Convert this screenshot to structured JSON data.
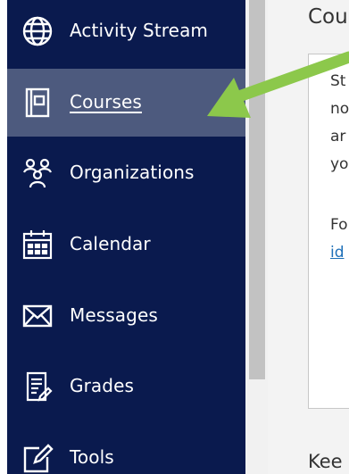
{
  "sidebar": {
    "items": [
      {
        "label": "Activity Stream",
        "icon": "globe-icon",
        "active": false
      },
      {
        "label": "Courses",
        "icon": "courses-book-icon",
        "active": true
      },
      {
        "label": "Organizations",
        "icon": "organizations-people-icon",
        "active": false
      },
      {
        "label": "Calendar",
        "icon": "calendar-icon",
        "active": false
      },
      {
        "label": "Messages",
        "icon": "envelope-icon",
        "active": false
      },
      {
        "label": "Grades",
        "icon": "grades-document-icon",
        "active": false
      },
      {
        "label": "Tools",
        "icon": "tools-edit-icon",
        "active": false
      }
    ]
  },
  "main": {
    "title_partial": "Cou",
    "box_lines": [
      "St",
      "no",
      "ar",
      "yo"
    ],
    "box_line2": "Fo",
    "box_link": "id",
    "bottom_partial": "Kee"
  },
  "colors": {
    "sidebar_bg": "#0a1a4e",
    "active_bg": "#4d5a7e",
    "arrow": "#8cc84b",
    "link": "#1d6fb8"
  }
}
